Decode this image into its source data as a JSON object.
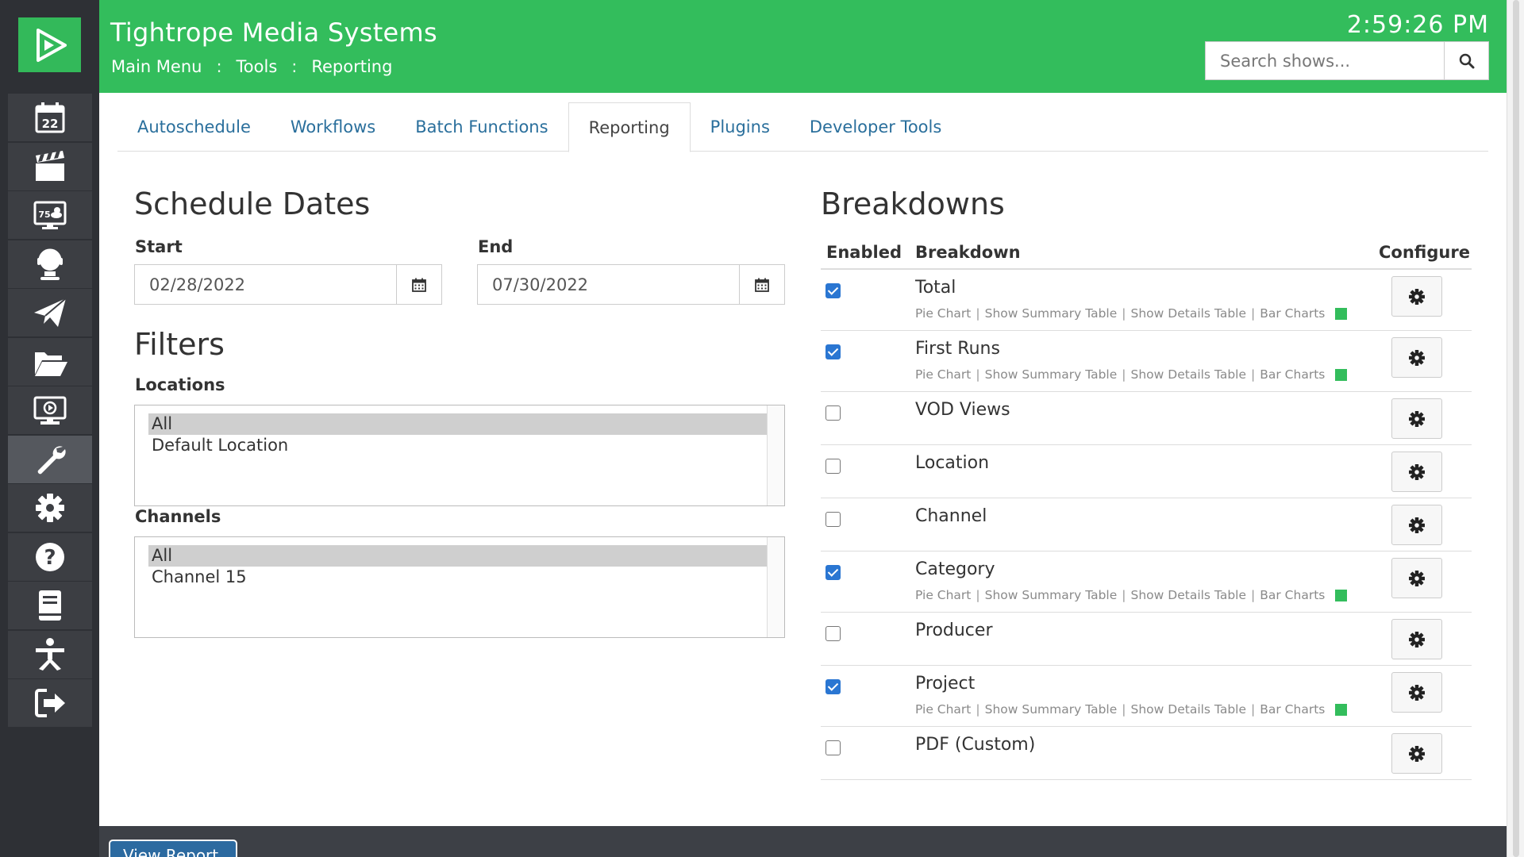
{
  "header": {
    "app_title": "Tightrope Media Systems",
    "breadcrumb": [
      "Main Menu",
      "Tools",
      "Reporting"
    ],
    "breadcrumb_separator": ":",
    "clock": "2:59:26 PM",
    "search": {
      "placeholder": "Search shows..."
    }
  },
  "sidebar": {
    "logo_icon": "play-logo-icon",
    "items": [
      {
        "icon": "calendar-icon",
        "calendar_day": "22"
      },
      {
        "icon": "clapperboard-icon"
      },
      {
        "icon": "weather-monitor-icon",
        "temperature": "75"
      },
      {
        "icon": "bulb-head-icon"
      },
      {
        "icon": "paper-plane-icon"
      },
      {
        "icon": "folder-open-icon"
      },
      {
        "icon": "monitor-play-icon"
      },
      {
        "icon": "wrench-icon",
        "active": true
      },
      {
        "icon": "gear-icon"
      },
      {
        "icon": "help-icon"
      },
      {
        "icon": "book-icon"
      },
      {
        "icon": "network-icon"
      },
      {
        "icon": "logout-icon"
      }
    ]
  },
  "tabs": [
    {
      "label": "Autoschedule"
    },
    {
      "label": "Workflows"
    },
    {
      "label": "Batch Functions"
    },
    {
      "label": "Reporting",
      "active": true
    },
    {
      "label": "Plugins"
    },
    {
      "label": "Developer Tools"
    }
  ],
  "schedule": {
    "title": "Schedule Dates",
    "start_label": "Start",
    "start_value": "02/28/2022",
    "end_label": "End",
    "end_value": "07/30/2022"
  },
  "filters": {
    "title": "Filters",
    "locations_label": "Locations",
    "locations": [
      {
        "label": "All",
        "selected": true
      },
      {
        "label": "Default Location"
      }
    ],
    "channels_label": "Channels",
    "channels": [
      {
        "label": "All",
        "selected": true
      },
      {
        "label": "Channel 15"
      }
    ]
  },
  "breakdowns": {
    "title": "Breakdowns",
    "col_enabled": "Enabled",
    "col_breakdown": "Breakdown",
    "col_configure": "Configure",
    "link_labels": [
      "Pie Chart",
      "Show Summary Table",
      "Show Details Table",
      "Bar Charts"
    ],
    "status_color": "#33bd5c",
    "rows": [
      {
        "name": "Total",
        "enabled": true
      },
      {
        "name": "First Runs",
        "enabled": true
      },
      {
        "name": "VOD Views",
        "enabled": false
      },
      {
        "name": "Location",
        "enabled": false
      },
      {
        "name": "Channel",
        "enabled": false
      },
      {
        "name": "Category",
        "enabled": true
      },
      {
        "name": "Producer",
        "enabled": false
      },
      {
        "name": "Project",
        "enabled": true
      },
      {
        "name": "PDF (Custom)",
        "enabled": false
      }
    ]
  },
  "footer": {
    "view_report_label": "View Report"
  },
  "colors": {
    "brand_green": "#33bd5c",
    "link_blue": "#2a6f9c",
    "sidebar_bg": "#2e3035",
    "check_blue": "#2a76d2"
  }
}
